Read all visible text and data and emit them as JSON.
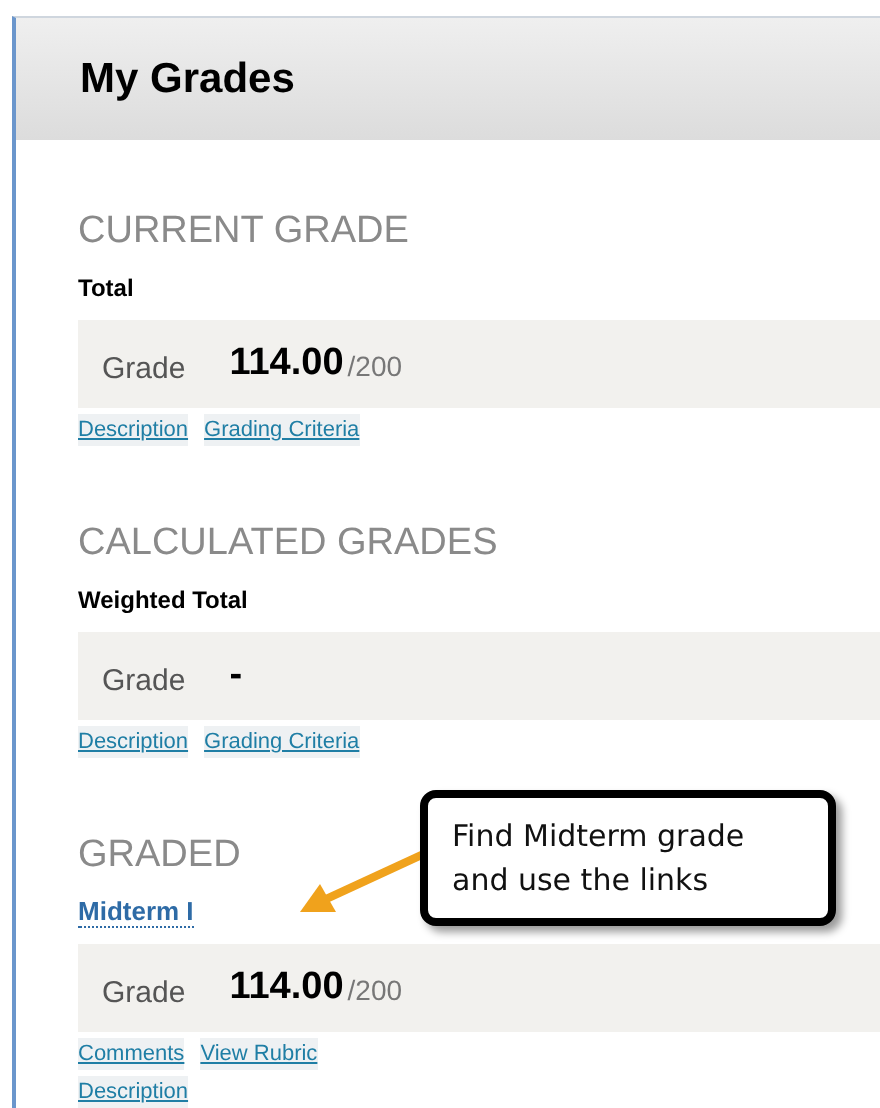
{
  "header": {
    "title": "My Grades"
  },
  "sections": [
    {
      "heading": "CURRENT GRADE",
      "item": {
        "kind": "label",
        "text": "Total"
      },
      "grade": {
        "label": "Grade",
        "value": "114.00",
        "total": "/200"
      },
      "link_rows": [
        [
          "Description",
          "Grading Criteria"
        ]
      ]
    },
    {
      "heading": "CALCULATED GRADES",
      "item": {
        "kind": "label",
        "text": "Weighted Total"
      },
      "grade": {
        "label": "Grade",
        "value": "-"
      },
      "link_rows": [
        [
          "Description",
          "Grading Criteria"
        ]
      ]
    },
    {
      "heading": "GRADED",
      "item": {
        "kind": "link",
        "text": "Midterm I"
      },
      "grade": {
        "label": "Grade",
        "value": "114.00",
        "total": "/200"
      },
      "link_rows": [
        [
          "Comments",
          "View Rubric"
        ],
        [
          "Description"
        ]
      ]
    }
  ],
  "callout": {
    "text": "Find Midterm grade and use the links"
  }
}
